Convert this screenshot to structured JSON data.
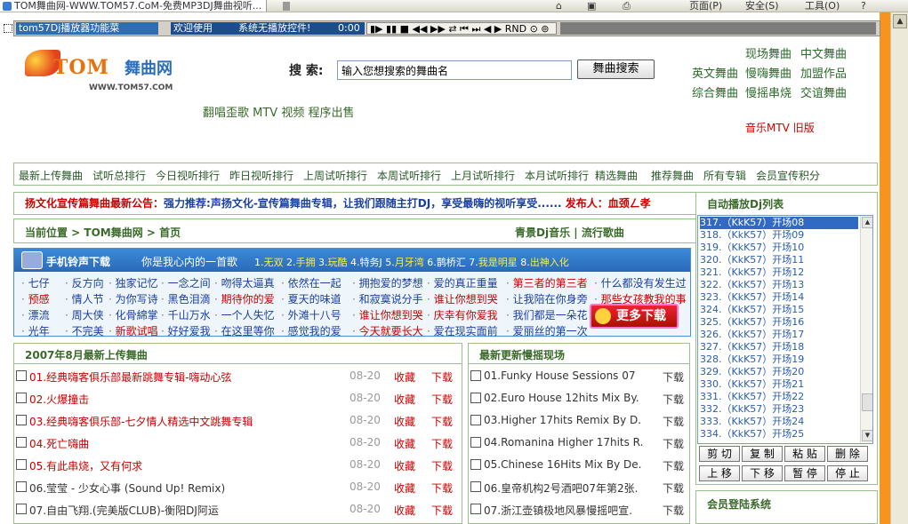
{
  "browser": {
    "tab_title": "TOM舞曲网-WWW.TOM57.CoM-免费MP3DJ舞曲视听...",
    "toolbar_page": "页面(P)",
    "toolbar_safety": "安全(S)",
    "toolbar_tools": "工具(O)",
    "toolbar_help": "?"
  },
  "player": {
    "title": "tom57Dj播放器功能菜",
    "status_left": "欢迎使用",
    "status_mid": "系统无播放控件!",
    "time": "0:00",
    "controls": "▮▶ ▮▮ ■ ◀◀ ▶▶ ⇄ ⏮ ⏭ ◀ ▶ RND ⊙ ⊚"
  },
  "header": {
    "logo_text": "TOM",
    "logo_text_cn": "舞曲网",
    "logo_url": "WWW.TOM57.COM",
    "search_label": "搜 索:",
    "search_value": "输入您想搜索的舞曲名",
    "search_button": "舞曲搜索",
    "top_links": [
      {
        "label": "现场舞曲"
      },
      {
        "label": "中文舞曲"
      },
      {
        "label": "英文舞曲"
      },
      {
        "label": "慢嗨舞曲"
      },
      {
        "label": "加盟作品"
      },
      {
        "label": "综合舞曲"
      },
      {
        "label": "慢摇串烧"
      },
      {
        "label": "交谊舞曲"
      }
    ],
    "sublinks": "翻唱歪歌 MTV 视频 程序出售",
    "red_links": "音乐MTV  旧版"
  },
  "nav": [
    "最新上传舞曲",
    "试听总排行",
    "今日视听排行",
    "昨日视听排行",
    "上周试听排行",
    "本周试听排行",
    "上月试听排行",
    "本月试听排行",
    "精选舞曲",
    "推荐舞曲",
    "所有专辑",
    "会员宣传积分"
  ],
  "notice": {
    "prefix": "扬文化宣传篇舞曲最新公告：",
    "body": "强力推荐:声扬文化-宣传篇舞曲专辑，让我们跟随主打DJ，享受最嗨的视听享受......",
    "publisher_label": "发布人：",
    "publisher": "血颈ㄥ孝"
  },
  "breadcrumb": {
    "label": "当前位置 > TOM舞曲网 > 首页",
    "right": "青景Dj音乐 | 流行歌曲"
  },
  "ring": {
    "title": "手机铃声下载",
    "subtitle": "你是我心内的一首歌",
    "top": [
      {
        "n": "1.",
        "t": "无双"
      },
      {
        "n": "2.",
        "t": "手拥"
      },
      {
        "n": "3.",
        "t": "玩酷"
      },
      {
        "n": "4.",
        "t": "特务J"
      },
      {
        "n": "5.",
        "t": "月牙湾"
      },
      {
        "n": "6.",
        "t": "鹊桥汇"
      },
      {
        "n": "7.",
        "t": "我是明星"
      },
      {
        "n": "8.",
        "t": "出神入化"
      }
    ],
    "rows": [
      [
        "七仔",
        "反方向",
        "独家记忆",
        "一念之间",
        "吻得太逼真",
        "依然在一起",
        "拥抱爱的梦想",
        "爱的真正重量",
        "第三者的第三者",
        "什么都没有发生过"
      ],
      [
        "预感",
        "情人节",
        "为你写诗",
        "黑色泪滴",
        "期待你的爱",
        "夏天的味道",
        "和寂寞说分手",
        "谁让你想到哭",
        "让我陪在你身旁",
        "那些女孩教我的事"
      ],
      [
        "漂流",
        "周大侠",
        "化骨綿掌",
        "千山万水",
        "一个人失忆",
        "外滩十八号",
        "谁让你想到哭",
        "庆幸有你爱我",
        "我们都是一朵花"
      ],
      [
        "光年",
        "不完美",
        "新歌试唱",
        "好好爱我",
        "在这里等你",
        "感觉我的爱",
        "今天就要长大",
        "爱在现实面前",
        "爱丽丝的第一次"
      ]
    ],
    "more": "更多下载"
  },
  "latest": {
    "title": "2007年8月最新上传舞曲",
    "collect": "收藏",
    "download": "下载",
    "items": [
      {
        "name": "01.经典嗨客俱乐部最新跳舞专辑-嗨动心弦",
        "date": "08-20"
      },
      {
        "name": "02.火爆撞击",
        "date": "08-20"
      },
      {
        "name": "03.经典嗨客俱乐部-七夕情人精选中文跳舞专辑",
        "date": "08-20"
      },
      {
        "name": "04.死亡嗨曲",
        "date": "08-20"
      },
      {
        "name": "05.有此串烧，又有何求",
        "date": "08-20"
      },
      {
        "name": "06.莹莹 - 少女心事 (Sound Up! Remix)",
        "date": "08-20"
      },
      {
        "name": "07.自由飞翔.(完美版CLUB)-衡阳DJ阿运",
        "date": "08-20"
      }
    ]
  },
  "dj": {
    "title": "最新更新慢摇现场",
    "download": "下载",
    "items": [
      {
        "name": "01.Funky House Sessions 07"
      },
      {
        "name": "02.Euro House 12hits Mix By."
      },
      {
        "name": "03.Higher 17hits Remix By D."
      },
      {
        "name": "04.Romanina Higher 17hits R."
      },
      {
        "name": "05.Chinese 16Hits Mix By De."
      },
      {
        "name": "06.皇帝机构2号酒吧07年第2张."
      },
      {
        "name": "07.浙江壶镇极地风暴慢摇吧宣."
      }
    ]
  },
  "autoplay": {
    "title": "自动播放Dj列表",
    "items": [
      "317.（KkK57）开场08",
      "318.（KkK57）开场09",
      "319.（KkK57）开场10",
      "320.（KkK57）开场11",
      "321.（KkK57）开场12",
      "322.（KkK57）开场13",
      "323.（KkK57）开场14",
      "324.（KkK57）开场15",
      "325.（KkK57）开场16",
      "326.（KkK57）开场17",
      "327.（KkK57）开场18",
      "328.（KkK57）开场19",
      "329.（KkK57）开场20",
      "330.（KkK57）开场21",
      "331.（KkK57）开场22",
      "332.（KkK57）开场23",
      "333.（KkK57）开场24",
      "334.（KkK57）开场25"
    ],
    "buttons": [
      "剪 切",
      "复 制",
      "粘 贴",
      "删 除",
      "上 移",
      "下 移",
      "暂 停",
      "停 止"
    ]
  },
  "login": {
    "title": "会员登陆系统"
  },
  "colors": {
    "accent_red": "#cc0000",
    "green_text": "#2a6a2a",
    "blue_header": "#2b6ab9",
    "orange_strip": "#f7941d"
  }
}
